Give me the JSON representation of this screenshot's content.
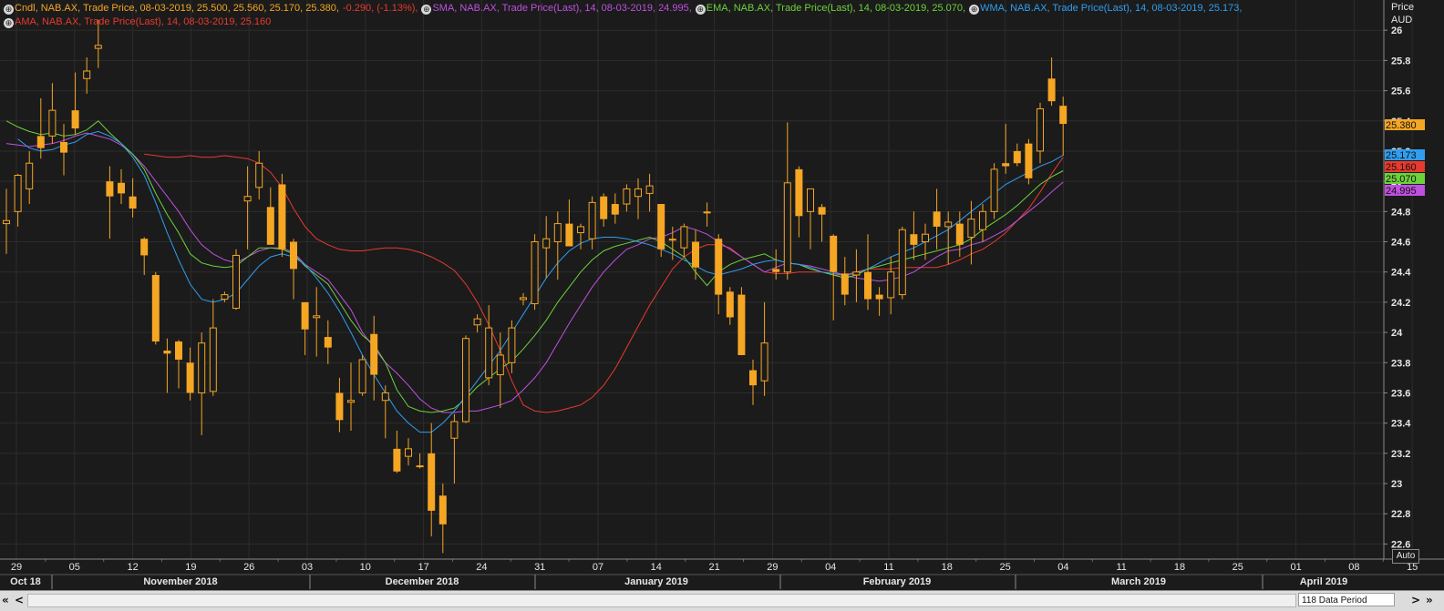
{
  "legend": {
    "rows": [
      [
        {
          "text": "Cndl, NAB.AX, Trade Price,  08-03-2019, 25.500, 25.560, 25.170, 25.380, ",
          "color": "#f5a623"
        },
        {
          "text": "-0.290, (-1.13%),",
          "color": "#e83a2e"
        },
        {
          "text": "SMA, NAB.AX, Trade Price(Last),  14, 08-03-2019, 24.995,",
          "color": "#c050e0"
        },
        {
          "text": "EMA, NAB.AX, Trade Price(Last),  14, 08-03-2019, 25.070,",
          "color": "#6cd23a"
        },
        {
          "text": "WMA, NAB.AX, Trade Price(Last),  14, 08-03-2019, 25.173,",
          "color": "#2f9ef0"
        }
      ],
      [
        {
          "text": "AMA, NAB.AX, Trade Price(Last),  14, 08-03-2019, 25.160",
          "color": "#e83a2e"
        }
      ]
    ]
  },
  "axis": {
    "title_line1": "Price",
    "title_line2": "AUD",
    "auto_label": "Auto",
    "period_label": "118 Data Period"
  },
  "nav": {
    "first": "«",
    "prev": "<",
    "next": ">",
    "last": "»"
  },
  "price_badges": [
    {
      "value": "25.380",
      "price": 25.38,
      "bg": "#f5a623",
      "fg": "#111111"
    },
    {
      "value": "25.173",
      "price": 25.173,
      "bg": "#2f9ef0",
      "fg": "#111111"
    },
    {
      "value": "25.160",
      "price": 25.16,
      "bg": "#e83a2e",
      "fg": "#111111"
    },
    {
      "value": "25.070",
      "price": 25.07,
      "bg": "#6cd23a",
      "fg": "#111111"
    },
    {
      "value": "24.995",
      "price": 24.995,
      "bg": "#c050e0",
      "fg": "#111111"
    }
  ],
  "colors": {
    "background": "#1b1b1b",
    "grid": "#2c2c2c",
    "candle": "#f5a623",
    "sma": "#c050e0",
    "ema": "#6cd23a",
    "wma": "#2f9ef0",
    "ama": "#e83a2e",
    "axis_text": "#e6e6e6"
  },
  "chart_data": {
    "type": "candlestick",
    "symbol": "NAB.AX",
    "ylim": [
      22.5,
      26.2
    ],
    "yticks": [
      "22.6",
      "22.8",
      "23",
      "23.2",
      "23.4",
      "23.6",
      "23.8",
      "24",
      "24.2",
      "24.4",
      "24.6",
      "24.8",
      "25",
      "25.2",
      "25.4",
      "25.6",
      "25.8",
      "26"
    ],
    "xticks": [
      "29",
      "05",
      "12",
      "19",
      "26",
      "03",
      "10",
      "17",
      "24",
      "31",
      "07",
      "14",
      "21",
      "29",
      "04",
      "11",
      "18",
      "25",
      "04",
      "11",
      "18",
      "25",
      "01",
      "08",
      "15"
    ],
    "month_labels": [
      "Oct 18",
      "November 2018",
      "December 2018",
      "January 2019",
      "February 2019",
      "March 2019",
      "April 2019"
    ],
    "candles": [
      {
        "o": 24.72,
        "h": 24.95,
        "l": 24.52,
        "c": 24.74
      },
      {
        "o": 24.8,
        "h": 25.05,
        "l": 24.7,
        "c": 25.04
      },
      {
        "o": 24.95,
        "h": 25.2,
        "l": 24.85,
        "c": 25.12
      },
      {
        "o": 25.3,
        "h": 25.55,
        "l": 25.15,
        "c": 25.22
      },
      {
        "o": 25.3,
        "h": 25.65,
        "l": 25.25,
        "c": 25.47
      },
      {
        "o": 25.26,
        "h": 25.38,
        "l": 25.04,
        "c": 25.19
      },
      {
        "o": 25.47,
        "h": 25.72,
        "l": 25.31,
        "c": 25.35
      },
      {
        "o": 25.68,
        "h": 25.82,
        "l": 25.58,
        "c": 25.73
      },
      {
        "o": 25.88,
        "h": 26.07,
        "l": 25.75,
        "c": 25.9
      },
      {
        "o": 25.0,
        "h": 25.1,
        "l": 24.62,
        "c": 24.9
      },
      {
        "o": 24.99,
        "h": 25.08,
        "l": 24.85,
        "c": 24.92
      },
      {
        "o": 24.9,
        "h": 25.02,
        "l": 24.76,
        "c": 24.82
      },
      {
        "o": 24.62,
        "h": 24.63,
        "l": 24.38,
        "c": 24.51
      },
      {
        "o": 24.38,
        "h": 24.4,
        "l": 23.92,
        "c": 23.94
      },
      {
        "o": 23.88,
        "h": 23.96,
        "l": 23.6,
        "c": 23.86
      },
      {
        "o": 23.94,
        "h": 23.95,
        "l": 23.63,
        "c": 23.82
      },
      {
        "o": 23.8,
        "h": 23.9,
        "l": 23.55,
        "c": 23.6
      },
      {
        "o": 23.6,
        "h": 24.0,
        "l": 23.32,
        "c": 23.93
      },
      {
        "o": 23.61,
        "h": 24.22,
        "l": 23.58,
        "c": 24.03
      },
      {
        "o": 24.22,
        "h": 24.27,
        "l": 24.2,
        "c": 24.25
      },
      {
        "o": 24.16,
        "h": 24.55,
        "l": 24.15,
        "c": 24.51
      },
      {
        "o": 24.87,
        "h": 25.1,
        "l": 24.55,
        "c": 24.9
      },
      {
        "o": 24.96,
        "h": 25.2,
        "l": 24.88,
        "c": 25.12
      },
      {
        "o": 24.83,
        "h": 24.96,
        "l": 24.58,
        "c": 24.58
      },
      {
        "o": 24.98,
        "h": 25.05,
        "l": 24.5,
        "c": 24.55
      },
      {
        "o": 24.6,
        "h": 24.62,
        "l": 24.22,
        "c": 24.42
      },
      {
        "o": 24.2,
        "h": 24.2,
        "l": 23.85,
        "c": 24.02
      },
      {
        "o": 24.1,
        "h": 24.3,
        "l": 23.84,
        "c": 24.11
      },
      {
        "o": 23.97,
        "h": 24.08,
        "l": 23.79,
        "c": 23.9
      },
      {
        "o": 23.6,
        "h": 23.7,
        "l": 23.34,
        "c": 23.42
      },
      {
        "o": 23.54,
        "h": 23.8,
        "l": 23.35,
        "c": 23.55
      },
      {
        "o": 23.6,
        "h": 23.85,
        "l": 23.58,
        "c": 23.82
      },
      {
        "o": 23.99,
        "h": 24.11,
        "l": 23.55,
        "c": 23.72
      },
      {
        "o": 23.55,
        "h": 23.65,
        "l": 23.3,
        "c": 23.6
      },
      {
        "o": 23.23,
        "h": 23.35,
        "l": 23.07,
        "c": 23.08
      },
      {
        "o": 23.18,
        "h": 23.3,
        "l": 23.12,
        "c": 23.23
      },
      {
        "o": 23.12,
        "h": 23.2,
        "l": 23.1,
        "c": 23.11
      },
      {
        "o": 23.2,
        "h": 23.4,
        "l": 22.65,
        "c": 22.82
      },
      {
        "o": 22.92,
        "h": 23.0,
        "l": 22.54,
        "c": 22.73
      },
      {
        "o": 23.3,
        "h": 23.46,
        "l": 23.0,
        "c": 23.41
      },
      {
        "o": 23.41,
        "h": 23.98,
        "l": 23.4,
        "c": 23.96
      },
      {
        "o": 24.05,
        "h": 24.12,
        "l": 24.0,
        "c": 24.09
      },
      {
        "o": 23.7,
        "h": 24.18,
        "l": 23.65,
        "c": 24.03
      },
      {
        "o": 23.72,
        "h": 24.0,
        "l": 23.5,
        "c": 23.85
      },
      {
        "o": 23.8,
        "h": 24.08,
        "l": 23.73,
        "c": 24.03
      },
      {
        "o": 24.22,
        "h": 24.26,
        "l": 24.18,
        "c": 24.23
      },
      {
        "o": 24.19,
        "h": 24.65,
        "l": 24.15,
        "c": 24.6
      },
      {
        "o": 24.56,
        "h": 24.77,
        "l": 24.36,
        "c": 24.62
      },
      {
        "o": 24.6,
        "h": 24.8,
        "l": 24.35,
        "c": 24.72
      },
      {
        "o": 24.72,
        "h": 24.88,
        "l": 24.57,
        "c": 24.57
      },
      {
        "o": 24.66,
        "h": 24.72,
        "l": 24.55,
        "c": 24.7
      },
      {
        "o": 24.62,
        "h": 24.9,
        "l": 24.55,
        "c": 24.86
      },
      {
        "o": 24.9,
        "h": 24.92,
        "l": 24.7,
        "c": 24.75
      },
      {
        "o": 24.85,
        "h": 24.92,
        "l": 24.72,
        "c": 24.78
      },
      {
        "o": 24.85,
        "h": 24.98,
        "l": 24.8,
        "c": 24.95
      },
      {
        "o": 24.9,
        "h": 25.02,
        "l": 24.75,
        "c": 24.95
      },
      {
        "o": 24.92,
        "h": 25.05,
        "l": 24.8,
        "c": 24.97
      },
      {
        "o": 24.85,
        "h": 24.85,
        "l": 24.5,
        "c": 24.55
      },
      {
        "o": 24.62,
        "h": 24.7,
        "l": 24.48,
        "c": 24.61
      },
      {
        "o": 24.56,
        "h": 24.72,
        "l": 24.5,
        "c": 24.7
      },
      {
        "o": 24.6,
        "h": 24.68,
        "l": 24.35,
        "c": 24.43
      },
      {
        "o": 24.8,
        "h": 24.86,
        "l": 24.7,
        "c": 24.79
      },
      {
        "o": 24.62,
        "h": 24.65,
        "l": 24.12,
        "c": 24.25
      },
      {
        "o": 24.27,
        "h": 24.3,
        "l": 24.05,
        "c": 24.1
      },
      {
        "o": 24.25,
        "h": 24.3,
        "l": 23.85,
        "c": 23.85
      },
      {
        "o": 23.75,
        "h": 23.82,
        "l": 23.52,
        "c": 23.65
      },
      {
        "o": 23.68,
        "h": 24.2,
        "l": 23.58,
        "c": 23.93
      },
      {
        "o": 24.42,
        "h": 24.55,
        "l": 24.35,
        "c": 24.4
      },
      {
        "o": 24.4,
        "h": 25.39,
        "l": 24.35,
        "c": 24.99
      },
      {
        "o": 25.08,
        "h": 25.1,
        "l": 24.63,
        "c": 24.77
      },
      {
        "o": 24.8,
        "h": 24.95,
        "l": 24.55,
        "c": 24.95
      },
      {
        "o": 24.83,
        "h": 24.85,
        "l": 24.6,
        "c": 24.78
      },
      {
        "o": 24.64,
        "h": 24.65,
        "l": 24.08,
        "c": 24.4
      },
      {
        "o": 24.39,
        "h": 24.5,
        "l": 24.18,
        "c": 24.25
      },
      {
        "o": 24.38,
        "h": 24.55,
        "l": 24.2,
        "c": 24.4
      },
      {
        "o": 24.4,
        "h": 24.65,
        "l": 24.15,
        "c": 24.22
      },
      {
        "o": 24.25,
        "h": 24.3,
        "l": 24.11,
        "c": 24.22
      },
      {
        "o": 24.23,
        "h": 24.5,
        "l": 24.12,
        "c": 24.4
      },
      {
        "o": 24.25,
        "h": 24.7,
        "l": 24.22,
        "c": 24.68
      },
      {
        "o": 24.65,
        "h": 24.8,
        "l": 24.48,
        "c": 24.58
      },
      {
        "o": 24.6,
        "h": 24.72,
        "l": 24.48,
        "c": 24.65
      },
      {
        "o": 24.8,
        "h": 24.95,
        "l": 24.55,
        "c": 24.7
      },
      {
        "o": 24.7,
        "h": 24.8,
        "l": 24.45,
        "c": 24.73
      },
      {
        "o": 24.72,
        "h": 24.8,
        "l": 24.5,
        "c": 24.58
      },
      {
        "o": 24.63,
        "h": 24.87,
        "l": 24.45,
        "c": 24.75
      },
      {
        "o": 24.68,
        "h": 24.85,
        "l": 24.6,
        "c": 24.8
      },
      {
        "o": 24.8,
        "h": 25.12,
        "l": 24.75,
        "c": 25.08
      },
      {
        "o": 25.12,
        "h": 25.38,
        "l": 25.05,
        "c": 25.1
      },
      {
        "o": 25.2,
        "h": 25.25,
        "l": 25.1,
        "c": 25.12
      },
      {
        "o": 25.25,
        "h": 25.28,
        "l": 24.98,
        "c": 25.02
      },
      {
        "o": 25.2,
        "h": 25.52,
        "l": 25.12,
        "c": 25.48
      },
      {
        "o": 25.68,
        "h": 25.82,
        "l": 25.5,
        "c": 25.53
      },
      {
        "o": 25.5,
        "h": 25.56,
        "l": 25.17,
        "c": 25.38
      }
    ],
    "sma": [
      25.25,
      25.24,
      25.23,
      25.24,
      25.25,
      25.27,
      25.3,
      25.32,
      25.3,
      25.28,
      25.24,
      25.18,
      25.1,
      25.0,
      24.9,
      24.8,
      24.68,
      24.58,
      24.52,
      24.48,
      24.46,
      24.5,
      24.54,
      24.56,
      24.56,
      24.53,
      24.45,
      24.4,
      24.35,
      24.25,
      24.15,
      24.0,
      23.9,
      23.8,
      23.73,
      23.65,
      23.56,
      23.5,
      23.47,
      23.47,
      23.48,
      23.48,
      23.5,
      23.52,
      23.55,
      23.62,
      23.7,
      23.8,
      23.93,
      24.06,
      24.18,
      24.3,
      24.4,
      24.48,
      24.55,
      24.58,
      24.62,
      24.63,
      24.66,
      24.7,
      24.68,
      24.65,
      24.6,
      24.55,
      24.5,
      24.45,
      24.4,
      24.43,
      24.46,
      24.45,
      24.44,
      24.42,
      24.4,
      24.38,
      24.36,
      24.35,
      24.34,
      24.35,
      24.37,
      24.4,
      24.45,
      24.5,
      24.54,
      24.55,
      24.58,
      24.6,
      24.64,
      24.68,
      24.74,
      24.8,
      24.86,
      24.93,
      24.995
    ],
    "ema": [
      25.4,
      25.36,
      25.33,
      25.31,
      25.32,
      25.3,
      25.31,
      25.34,
      25.4,
      25.32,
      25.25,
      25.18,
      25.08,
      24.92,
      24.78,
      24.66,
      24.52,
      24.46,
      24.44,
      24.43,
      24.44,
      24.5,
      24.56,
      24.56,
      24.55,
      24.52,
      24.44,
      24.38,
      24.32,
      24.2,
      24.08,
      23.98,
      23.92,
      23.8,
      23.62,
      23.51,
      23.48,
      23.47,
      23.48,
      23.5,
      23.56,
      23.64,
      23.7,
      23.76,
      23.81,
      23.89,
      23.98,
      24.08,
      24.2,
      24.3,
      24.4,
      24.48,
      24.54,
      24.57,
      24.59,
      24.61,
      24.63,
      24.6,
      24.55,
      24.5,
      24.4,
      24.31,
      24.4,
      24.45,
      24.48,
      24.5,
      24.52,
      24.48,
      24.46,
      24.45,
      24.42,
      24.4,
      24.38,
      24.36,
      24.38,
      24.42,
      24.44,
      24.46,
      24.48,
      24.5,
      24.52,
      24.54,
      24.56,
      24.58,
      24.62,
      24.68,
      24.73,
      24.78,
      24.84,
      24.91,
      24.98,
      25.03,
      25.07
    ],
    "wma": [
      25.28,
      25.22,
      25.2,
      25.21,
      25.24,
      25.26,
      25.31,
      25.33,
      25.3,
      25.25,
      25.16,
      25.04,
      24.86,
      24.66,
      24.48,
      24.32,
      24.22,
      24.2,
      24.22,
      24.26,
      24.35,
      24.44,
      24.5,
      24.52,
      24.5,
      24.45,
      24.36,
      24.26,
      24.14,
      24.0,
      23.85,
      23.72,
      23.6,
      23.48,
      23.4,
      23.34,
      23.34,
      23.4,
      23.48,
      23.58,
      23.68,
      23.78,
      23.88,
      24.0,
      24.12,
      24.24,
      24.36,
      24.46,
      24.54,
      24.59,
      24.62,
      24.63,
      24.63,
      24.62,
      24.6,
      24.58,
      24.55,
      24.52,
      24.48,
      24.44,
      24.4,
      24.38,
      24.4,
      24.42,
      24.45,
      24.47,
      24.48,
      24.46,
      24.45,
      24.43,
      24.4,
      24.39,
      24.38,
      24.39,
      24.42,
      24.46,
      24.5,
      24.53,
      24.56,
      24.6,
      24.64,
      24.68,
      24.74,
      24.8,
      24.86,
      24.92,
      24.98,
      25.02,
      25.06,
      25.1,
      25.13,
      25.173
    ],
    "ama": [
      25.18,
      25.17,
      25.16,
      25.16,
      25.17,
      25.16,
      25.16,
      25.17,
      25.16,
      25.15,
      25.12,
      25.06,
      24.96,
      24.82,
      24.7,
      24.62,
      24.58,
      24.55,
      24.54,
      24.54,
      24.55,
      24.56,
      24.56,
      24.55,
      24.53,
      24.5,
      24.46,
      24.41,
      24.32,
      24.2,
      24.05,
      23.88,
      23.68,
      23.52,
      23.48,
      23.47,
      23.48,
      23.5,
      23.52,
      23.57,
      23.65,
      23.76,
      23.9,
      24.04,
      24.18,
      24.3,
      24.42,
      24.5,
      24.55,
      24.58,
      24.58,
      24.56,
      24.5,
      24.45,
      24.4,
      24.39,
      24.39,
      24.4,
      24.4,
      24.4,
      24.38,
      24.38,
      24.4,
      24.42,
      24.42,
      24.42,
      24.43,
      24.43,
      24.43,
      24.43,
      24.45,
      24.48,
      24.52,
      24.55,
      24.6,
      24.66,
      24.74,
      24.82,
      24.93,
      25.05,
      25.16
    ]
  }
}
